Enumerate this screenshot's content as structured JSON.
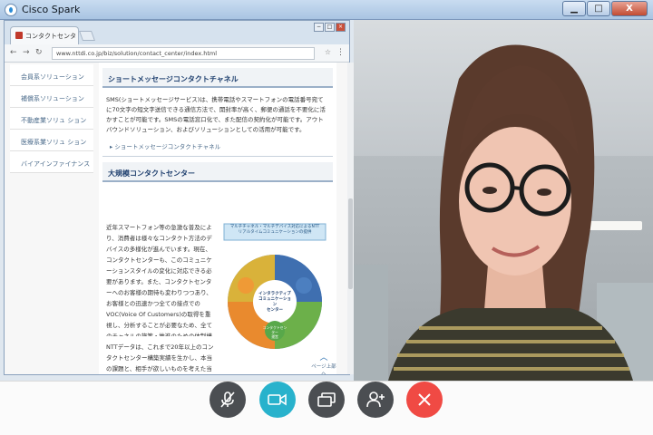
{
  "app": {
    "title": "Cisco Spark"
  },
  "window_controls": {
    "minimize": "▁",
    "maximize": "□",
    "close": "X"
  },
  "browser": {
    "tab_title": "コンタクトセンタ ソ",
    "url": "www.nttdi.co.jp/biz/solution/contact_center/index.html",
    "window_controls": {
      "minimize": "−",
      "maximize": "□",
      "close": "×"
    }
  },
  "sidebar": {
    "items": [
      {
        "label": "会員系ソリューション"
      },
      {
        "label": "補償系ソリューション"
      },
      {
        "label": "不動産業ソリュ ション"
      },
      {
        "label": "医療系業ソリュ ション"
      },
      {
        "label": "バイアインファイナンス"
      }
    ]
  },
  "content": {
    "section1": {
      "heading": "ショートメッセージコンタクトチャネル",
      "paragraph": "SMS(ショートメッセージサービス)は、携帯電話やスマートフォンの電話番号宛てに70文字の短文字送信できる通信方法で、開封率が高く、郵便の通話を不要化に活かすことが可能です。SMSの電話窓口化で、また配信の契約化が可能です。アウトバウンドソリューション、およびソリューションとしての活用が可能です。",
      "link": "ショートメッセージコンタクトチャネル"
    },
    "section2": {
      "heading": "大規模コンタクトセンター",
      "paragraph": "近年スマートフォン等の急激な普及により、消費者は様々なコンタクト方法のデバイスの多様化が進んでいます。現在、コンタクトセンターも、このコミュニケーションスタイルの変化に対応できる必要があります。また、コンタクトセンターへのお客様の期待も変わりつつあり、お客様との迅速かつ全ての接点でのVOC(Voice Of Customers)の取得を重視し、分析することが必要なため、全てのチャネルの施策・推進のための体制構築のためのノウハウを重要になってきています。",
      "paragraph2": "NTTデータは、これまで20年以上のコンタクトセンター構築実績を生かし、本当の課題と、相手が欲しいものを考えた当社のセン"
    },
    "diagram": {
      "title_line1": "マルチチャネル・マルチデバイス対応によるNTT",
      "title_line2": "リアルタイムコミュニケーションの提供",
      "center_label_1": "インタラクティブ",
      "center_label_2": "コミュニケーション",
      "center_label_3": "センター",
      "sub_label_1": "コンタクトセンター",
      "sub_label_2": "運営"
    },
    "page_up": "ページ上部へ"
  },
  "controls": {
    "mute": {
      "icon": "mic-off-icon"
    },
    "video": {
      "icon": "video-icon"
    },
    "share": {
      "icon": "screen-share-icon"
    },
    "add": {
      "icon": "add-person-icon"
    },
    "end": {
      "icon": "end-call-icon"
    }
  },
  "colors": {
    "accent_teal": "#28b2cc",
    "end_red": "#f04a44",
    "control_dark": "#4b4e52"
  }
}
